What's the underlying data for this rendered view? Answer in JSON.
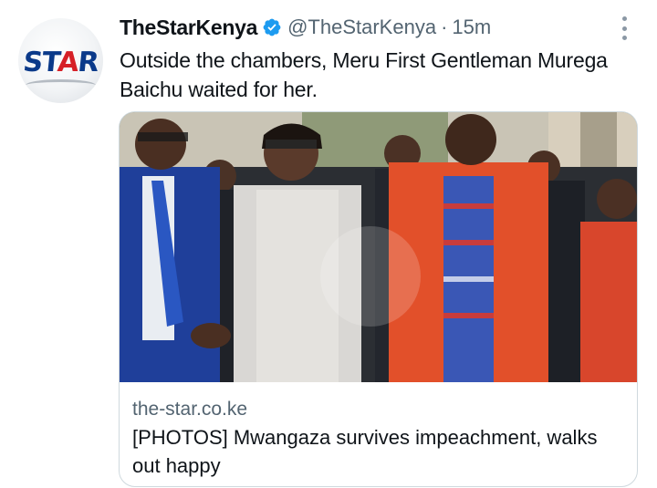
{
  "tweet": {
    "display_name": "TheStarKenya",
    "handle": "@TheStarKenya",
    "separator": "·",
    "time": "15m",
    "text": "Outside the chambers, Meru First Gentleman Murega Baichu waited for her."
  },
  "avatar": {
    "logo_text_part1": "ST",
    "logo_text_part2": "A",
    "logo_text_part3": "R"
  },
  "card": {
    "domain": "the-star.co.ke",
    "title": "[PHOTOS] Mwangaza survives impeachment, walks out happy"
  },
  "colors": {
    "verified": "#1d9bf0",
    "secondary_text": "#536471",
    "border": "#cfd9de"
  },
  "icons": {
    "verified": "verified-badge-icon",
    "more": "more-options-icon"
  }
}
